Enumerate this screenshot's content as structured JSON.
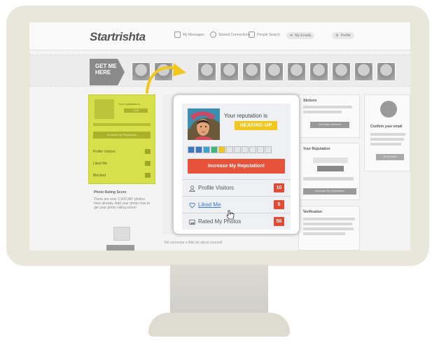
{
  "header": {
    "logo": "Startrishta",
    "nav": [
      {
        "label": "My Messages",
        "icon": "messages-icon"
      },
      {
        "label": "Shared Connections",
        "icon": "heart-icon"
      },
      {
        "label": "People Search",
        "icon": "search-icon"
      }
    ],
    "user_label": "My Emails",
    "profile_label": "Profile"
  },
  "strip": {
    "get_me_here": "GET ME HERE"
  },
  "left_box": {
    "reputation_label": "Your reputation is",
    "badge": "LOW",
    "button": "Increase My Reputation",
    "rows": [
      {
        "label": "Profile Visitors"
      },
      {
        "label": "Liked Me"
      },
      {
        "label": "Blocked"
      }
    ]
  },
  "left_lower": {
    "title": "Photo Rating Score",
    "text": "There are over 2,500,987 photos here already. Add your photo now to get your photo rating score!"
  },
  "middle": {
    "bottom_text": "Tell someone a little bit about yourself"
  },
  "right_col": {
    "stickers_title": "Stickers",
    "stickers_btn": "Get More Stickers",
    "reputation_title": "Your Reputation",
    "reputation_btn": "Increase My Reputation",
    "verification_title": "Verification",
    "confirm_title": "Confirm your email",
    "email_btn": "Email sent"
  },
  "popup": {
    "reputation_label": "Your reputation is",
    "status_badge": "HEATING UP",
    "meter": {
      "filled": 5,
      "total": 11,
      "colors": [
        "#3b78c4",
        "#3b78c4",
        "#3aa6c9",
        "#3fb87c",
        "#f2c71c"
      ]
    },
    "increase_button": "Increase My Reputation!",
    "rows": [
      {
        "label": "Profile Visitors",
        "count": "10",
        "icon": "person-icon"
      },
      {
        "label": "Liked Me",
        "count": "5",
        "icon": "heart-icon"
      },
      {
        "label": "Rated My Photos",
        "count": "56",
        "icon": "photo-icon"
      }
    ]
  },
  "colors": {
    "highlight": "#d6e04a",
    "badge": "#f2c71c",
    "accent_red": "#e8523a",
    "link": "#3a7bd5"
  }
}
